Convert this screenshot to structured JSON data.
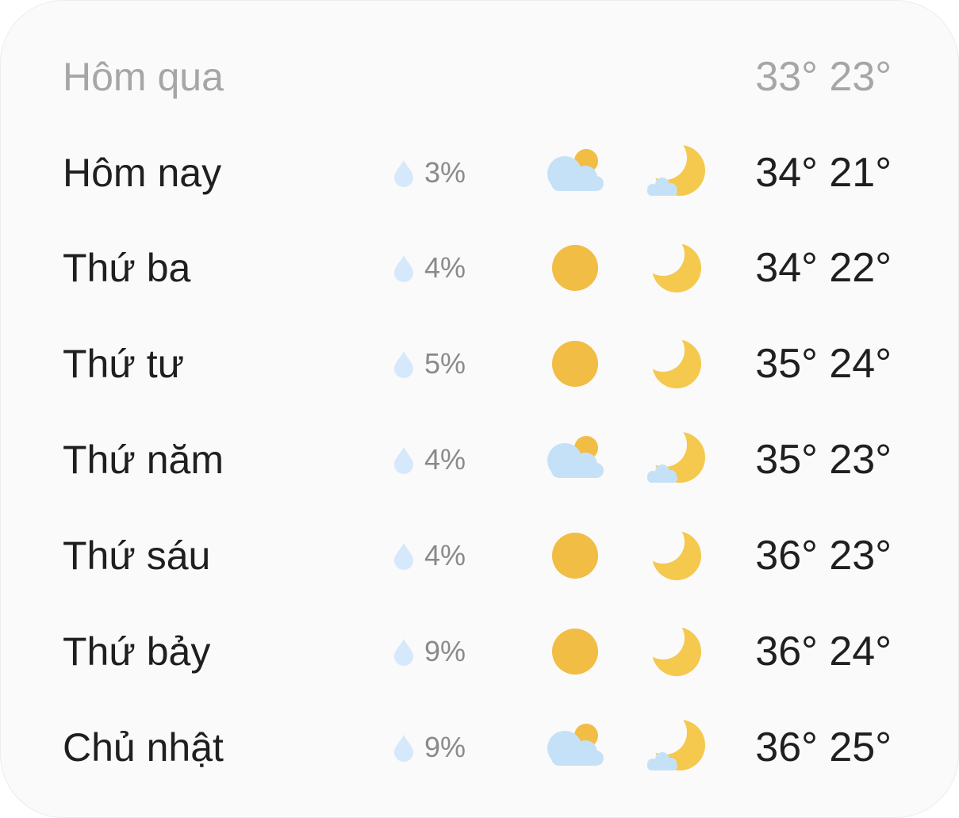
{
  "yesterday": {
    "label": "Hôm qua",
    "temps": "33° 23°"
  },
  "days": [
    {
      "label": "Hôm nay",
      "rain": "3%",
      "day_icon": "partly-cloudy-day-icon",
      "night_icon": "partly-cloudy-night-icon",
      "temps": "34° 21°"
    },
    {
      "label": "Thứ ba",
      "rain": "4%",
      "day_icon": "sun-icon",
      "night_icon": "moon-icon",
      "temps": "34° 22°"
    },
    {
      "label": "Thứ tư",
      "rain": "5%",
      "day_icon": "sun-icon",
      "night_icon": "moon-icon",
      "temps": "35° 24°"
    },
    {
      "label": "Thứ năm",
      "rain": "4%",
      "day_icon": "partly-cloudy-day-icon",
      "night_icon": "partly-cloudy-night-icon",
      "temps": "35° 23°"
    },
    {
      "label": "Thứ sáu",
      "rain": "4%",
      "day_icon": "sun-icon",
      "night_icon": "moon-icon",
      "temps": "36° 23°"
    },
    {
      "label": "Thứ bảy",
      "rain": "9%",
      "day_icon": "sun-icon",
      "night_icon": "moon-icon",
      "temps": "36° 24°"
    },
    {
      "label": "Chủ nhật",
      "rain": "9%",
      "day_icon": "partly-cloudy-day-icon",
      "night_icon": "partly-cloudy-night-icon",
      "temps": "36° 25°"
    }
  ],
  "colors": {
    "sun": "#f2bd44",
    "moon": "#f5c84e",
    "cloud": "#c5e1f8",
    "drop": "#d6e8fb",
    "text": "#1f1f1f",
    "muted": "#a6a6a6"
  }
}
